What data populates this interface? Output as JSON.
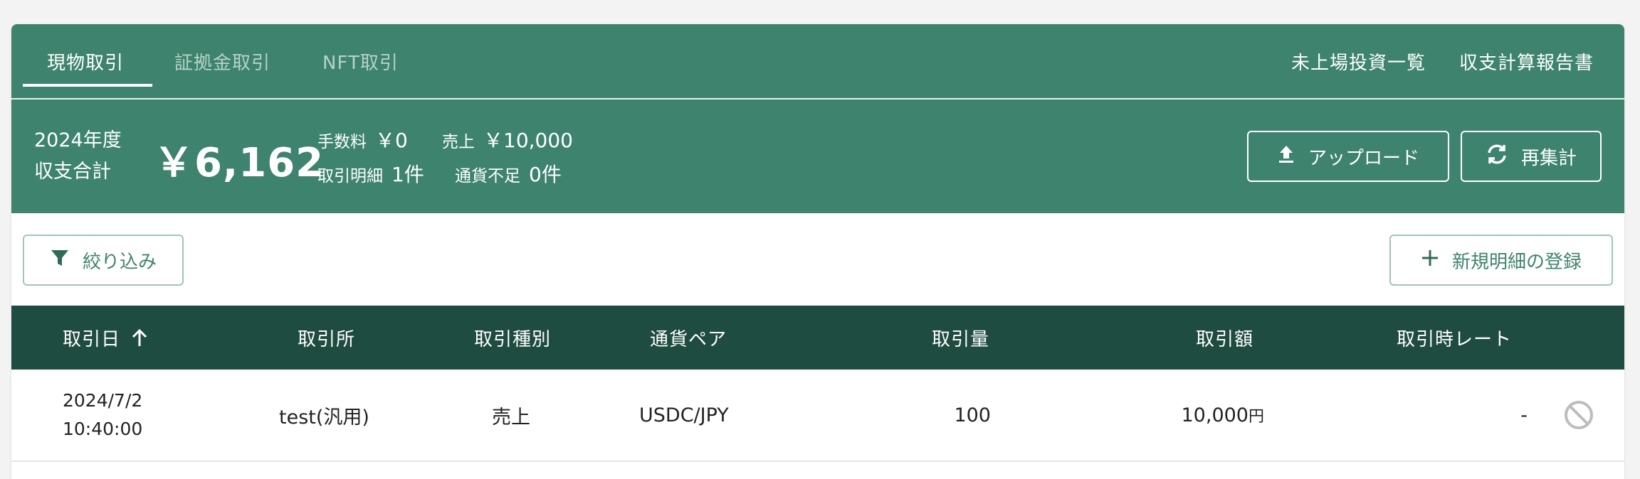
{
  "tabs": [
    {
      "label": "現物取引",
      "active": true
    },
    {
      "label": "証拠金取引",
      "active": false
    },
    {
      "label": "NFT取引",
      "active": false
    }
  ],
  "top_links": {
    "unlisted": "未上場投資一覧",
    "report": "収支計算報告書"
  },
  "summary": {
    "year_line1": "2024年度",
    "year_line2": "収支合計",
    "total": "￥6,162",
    "fee_label": "手数料",
    "fee_value": "￥0",
    "sales_label": "売上",
    "sales_value": "￥10,000",
    "detail_label": "取引明細",
    "detail_value": "1件",
    "shortage_label": "通貨不足",
    "shortage_value": "0件"
  },
  "buttons": {
    "upload": "アップロード",
    "recalc": "再集計",
    "filter": "絞り込み",
    "new_entry": "新規明細の登録"
  },
  "table": {
    "headers": {
      "date": "取引日",
      "exchange": "取引所",
      "type": "取引種別",
      "pair": "通貨ペア",
      "amount": "取引量",
      "value": "取引額",
      "rate": "取引時レート"
    },
    "rows": [
      {
        "date_line1": "2024/7/2",
        "date_line2": "10:40:00",
        "exchange": "test(汎用)",
        "type": "売上",
        "pair": "USDC/JPY",
        "amount": "100",
        "value": "10,000",
        "value_unit": "円",
        "rate": "-"
      }
    ]
  },
  "colors": {
    "header_green": "#3e836d",
    "table_header": "#1f4c40",
    "border_green": "#9fc6b8",
    "disabled_gray": "#bdbdbd"
  },
  "icons": {
    "upload": "upload-icon",
    "recalc": "refresh-icon",
    "filter": "filter-icon",
    "add": "plus-icon",
    "sort": "arrow-up-icon",
    "row_action": "block-icon"
  }
}
